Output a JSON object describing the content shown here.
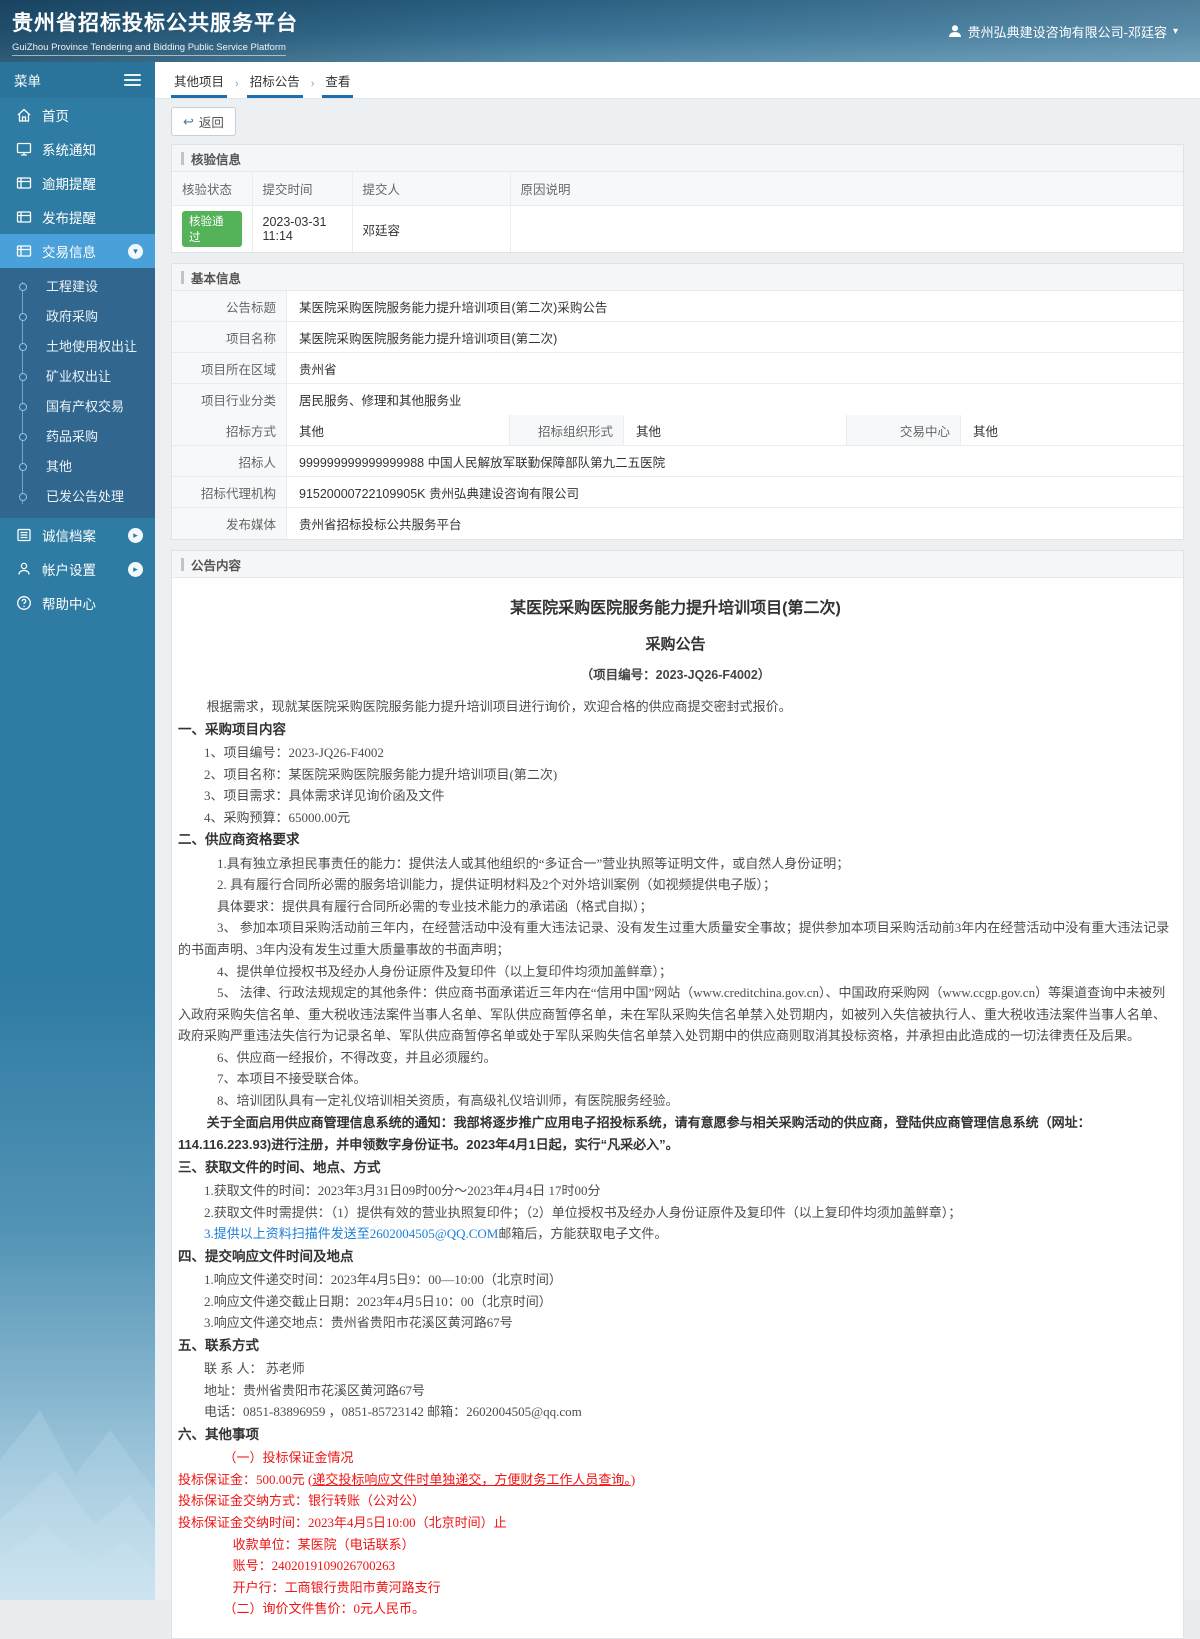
{
  "colors": {
    "accent": "#1d6fae",
    "sidebar": "#2e7ba3",
    "sidebar_active": "#4aa0d8",
    "badge_green": "#54b258",
    "doc_red": "#f01414",
    "doc_link_blue": "#1b7ed8"
  },
  "header": {
    "title": "贵州省招标投标公共服务平台",
    "subtitle": "GuiZhou Province Tendering and Bidding Public Service Platform",
    "user": "贵州弘典建设咨询有限公司-邓廷容"
  },
  "sidebar": {
    "menu_label": "菜单",
    "items_top": [
      {
        "label": "首页"
      },
      {
        "label": "系统通知"
      },
      {
        "label": "逾期提醒"
      },
      {
        "label": "发布提醒"
      },
      {
        "label": "交易信息"
      }
    ],
    "submenu": [
      "工程建设",
      "政府采购",
      "土地使用权出让",
      "矿业权出让",
      "国有产权交易",
      "药品采购",
      "其他",
      "已发公告处理"
    ],
    "items_bottom": [
      {
        "label": "诚信档案"
      },
      {
        "label": "帐户设置"
      },
      {
        "label": "帮助中心"
      }
    ]
  },
  "breadcrumb": [
    "其他项目",
    "招标公告",
    "查看"
  ],
  "toolbar": {
    "back_label": "返回"
  },
  "verify_section": {
    "title": "核验信息",
    "columns": [
      "核验状态",
      "提交时间",
      "提交人",
      "原因说明"
    ],
    "row": {
      "status": "核验通过",
      "time": "2023-03-31 11:14",
      "submitter": "邓廷容",
      "reason": ""
    }
  },
  "basic_section": {
    "title": "基本信息",
    "rows": [
      {
        "label": "公告标题",
        "value": "某医院采购医院服务能力提升培训项目(第二次)采购公告"
      },
      {
        "label": "项目名称",
        "value": "某医院采购医院服务能力提升培训项目(第二次)"
      },
      {
        "label": "项目所在区域",
        "value": "贵州省"
      },
      {
        "label": "项目行业分类",
        "value": "居民服务、修理和其他服务业"
      }
    ],
    "triple": [
      {
        "label": "招标方式",
        "value": "其他"
      },
      {
        "label": "招标组织形式",
        "value": "其他"
      },
      {
        "label": "交易中心",
        "value": "其他"
      }
    ],
    "rows2": [
      {
        "label": "招标人",
        "value": "999999999999999988 中国人民解放军联勤保障部队第九二五医院"
      },
      {
        "label": "招标代理机构",
        "value": "91520000722109905K 贵州弘典建设咨询有限公司"
      },
      {
        "label": "发布媒体",
        "value": "贵州省招标投标公共服务平台"
      }
    ]
  },
  "notice_section": {
    "title": "公告内容",
    "lines": [
      {
        "cls": "t1",
        "text": "某医院采购医院服务能力提升培训项目(第二次)"
      },
      {
        "cls": "t2",
        "text": "采购公告"
      },
      {
        "cls": "t3",
        "text": "（项目编号：2023-JQ26-F4002）"
      },
      {
        "cls": "para",
        "text": "根据需求，现就某医院采购医院服务能力提升培训项目进行询价，欢迎合格的供应商提交密封式报价。"
      },
      {
        "cls": "h",
        "text": "一、采购项目内容"
      },
      {
        "cls": "item",
        "text": "1、项目编号：2023-JQ26-F4002"
      },
      {
        "cls": "item",
        "text": "2、项目名称：某医院采购医院服务能力提升培训项目(第二次)"
      },
      {
        "cls": "item",
        "text": "3、项目需求：具体需求详见询价函及文件"
      },
      {
        "cls": "item",
        "text": "4、采购预算：65000.00元"
      },
      {
        "cls": "h",
        "text": "二、供应商资格要求"
      },
      {
        "cls": "item2",
        "text": "1.具有独立承担民事责任的能力：提供法人或其他组织的“多证合一”营业执照等证明文件，或自然人身份证明；"
      },
      {
        "cls": "item2",
        "text": "2. 具有履行合同所必需的服务培训能力，提供证明材料及2个对外培训案例（如视频提供电子版）；"
      },
      {
        "cls": "item2",
        "text": "具体要求：提供具有履行合同所必需的专业技术能力的承诺函（格式自拟）；"
      },
      {
        "cls": "just",
        "text": "3、 参加本项目采购活动前三年内，在经营活动中没有重大违法记录、没有发生过重大质量安全事故；提供参加本项目采购活动前3年内在经营活动中没有重大违法记录的书面声明、3年内没有发生过重大质量事故的书面声明；"
      },
      {
        "cls": "item2",
        "text": "4、提供单位授权书及经办人身份证原件及复印件（以上复印件均须加盖鲜章）；"
      },
      {
        "cls": "just",
        "text": "5、 法律、行政法规规定的其他条件：供应商书面承诺近三年内在“信用中国”网站（www.creditchina.gov.cn）、中国政府采购网（www.ccgp.gov.cn）等渠道查询中未被列入政府采购失信名单、重大税收违法案件当事人名单、军队供应商暂停名单，未在军队采购失信名单禁入处罚期内，如被列入失信被执行人、重大税收违法案件当事人名单、政府采购严重违法失信行为记录名单、军队供应商暂停名单或处于军队采购失信名单禁入处罚期中的供应商则取消其投标资格，并承担由此造成的一切法律责任及后果。"
      },
      {
        "cls": "item2",
        "text": "6、供应商一经报价，不得改变，并且必须履约。"
      },
      {
        "cls": "item2",
        "text": "7、本项目不接受联合体。"
      },
      {
        "cls": "item2",
        "text": "8、培训团队具有一定礼仪培训相关资质，有高级礼仪培训师，有医院服务经验。"
      },
      {
        "cls": "notice",
        "text": "关于全面启用供应商管理信息系统的通知：我部将逐步推广应用电子招投标系统，请有意愿参与相关采购活动的供应商，登陆供应商管理信息系统（网址：114.116.223.93)进行注册，并申领数字身份证书。2023年4月1日起，实行“凡采必入”。"
      },
      {
        "cls": "h",
        "text": "三、获取文件的时间、地点、方式"
      },
      {
        "cls": "item",
        "text": "1.获取文件的时间：2023年3月31日09时00分～2023年4月4日 17时00分"
      },
      {
        "cls": "item",
        "text": "2.获取文件时需提供：（1）提供有效的营业执照复印件；（2）单位授权书及经办人身份证原件及复印件（以上复印件均须加盖鲜章）；"
      },
      {
        "cls": "item",
        "segments": [
          {
            "text": "3.提供以上资料扫描件发送至2602004505@QQ.COM",
            "cls": "doc-link"
          },
          {
            "text": "邮箱后，方能获取电子文件。",
            "cls": ""
          }
        ]
      },
      {
        "cls": "h",
        "text": "四、提交响应文件时间及地点"
      },
      {
        "cls": "item",
        "text": "1.响应文件递交时间：2023年4月5日9：00—10:00（北京时间）"
      },
      {
        "cls": "item",
        "text": "2.响应文件递交截止日期：2023年4月5日10：00（北京时间）"
      },
      {
        "cls": "item",
        "text": "3.响应文件递交地点：贵州省贵阳市花溪区黄河路67号"
      },
      {
        "cls": "h",
        "text": "五、联系方式"
      },
      {
        "cls": "item",
        "text": "联 系 人： 苏老师"
      },
      {
        "cls": "item",
        "text": "地址：贵州省贵阳市花溪区黄河路67号"
      },
      {
        "cls": "item",
        "text": "电话：0851-83896959 ，0851-85723142  邮箱：2602004505@qq.com"
      },
      {
        "cls": "h",
        "text": "六、其他事项"
      },
      {
        "cls": "red ind2",
        "text": "（一）投标保证金情况"
      },
      {
        "cls": "red",
        "segments": [
          {
            "text": "投标保证金：500.00元 (",
            "cls": ""
          },
          {
            "text": "递交投标响应文件时单独递交，方便财务工作人员查询。",
            "cls": "u"
          },
          {
            "text": ")",
            "cls": ""
          }
        ]
      },
      {
        "cls": "red",
        "text": "投标保证金交纳方式：银行转账（公对公）"
      },
      {
        "cls": "red",
        "text": "投标保证金交纳时间：2023年4月5日10:00（北京时间）止"
      },
      {
        "cls": "red ind3",
        "text": "收款单位：某医院（电话联系）"
      },
      {
        "cls": "red ind3",
        "text": "账号：2402019109026700263"
      },
      {
        "cls": "red ind3",
        "text": "开户行：工商银行贵阳市黄河路支行"
      },
      {
        "cls": "red ind2",
        "text": "（二）询价文件售价：0元人民币。"
      }
    ]
  }
}
